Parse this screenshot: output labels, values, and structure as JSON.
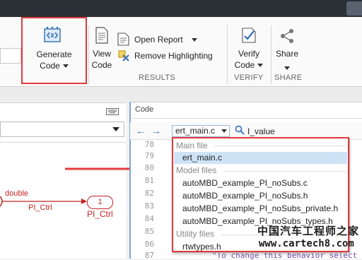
{
  "ribbon": {
    "generate_code": {
      "line1": "Generate",
      "line2": "Code"
    },
    "view_code": {
      "line1": "View",
      "line2": "Code"
    },
    "open_report": "Open Report",
    "remove_highlighting": "Remove Highlighting",
    "verify_code": {
      "line1": "Verify",
      "line2": "Code"
    },
    "share": "Share",
    "sections": {
      "results": "RESULTS",
      "verify": "VERIFY",
      "share": "SHARE"
    }
  },
  "diagram": {
    "signal_label": "double",
    "line_label": "PI_Ctrl",
    "outport_number": "1",
    "outport_label": "PI_Ctrl"
  },
  "code_pane": {
    "title": "Code",
    "file_select": "ert_main.c",
    "search_text": "I_value",
    "line_numbers": [
      "78",
      "79",
      "80",
      "81",
      "82",
      "83",
      "84",
      "85",
      "86",
      "87"
    ],
    "bottom_text": "\"To change this behavior select t"
  },
  "file_dropdown": {
    "groups": [
      {
        "label": "Main file",
        "items": [
          {
            "name": "ert_main.c",
            "selected": true
          }
        ]
      },
      {
        "label": "Model files",
        "items": [
          {
            "name": "autoMBD_example_PI_noSubs.c",
            "selected": false
          },
          {
            "name": "autoMBD_example_PI_noSubs.h",
            "selected": false
          },
          {
            "name": "autoMBD_example_PI_noSubs_private.h",
            "selected": false
          },
          {
            "name": "autoMBD_example_PI_noSubs_types.h",
            "selected": false
          }
        ]
      },
      {
        "label": "Utility files",
        "items": [
          {
            "name": "rtwtypes.h",
            "selected": false
          }
        ]
      }
    ]
  },
  "watermark": {
    "line1": "中国汽车工程师之家",
    "line2": "www.cartech8.com"
  },
  "colors": {
    "accent_red": "#e23b3b",
    "selection": "#cfe3f7",
    "signal_red": "#c42424"
  }
}
